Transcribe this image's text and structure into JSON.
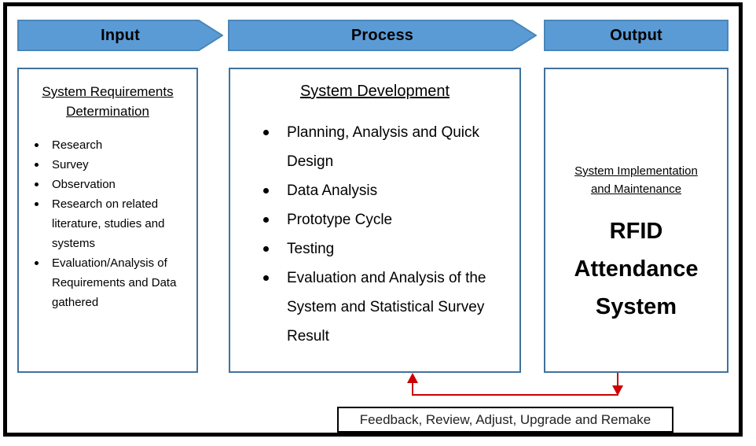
{
  "diagram": {
    "title": "Input Process Output diagram for RFID Attendance System",
    "accent_blue": "#5B9BD5",
    "box_border_blue": "#41719C",
    "feedback_red": "#CC0000",
    "frame_black": "#000000"
  },
  "headers": [
    {
      "label": "Input",
      "shape": "chevron-arrow"
    },
    {
      "label": "Process",
      "shape": "chevron-arrow"
    },
    {
      "label": "Output",
      "shape": "rectangle"
    }
  ],
  "columns": {
    "input": {
      "title_line1": "System Requirements",
      "title_line2": "Determination",
      "items": [
        "Research",
        "Survey",
        "Observation",
        "Research on related literature, studies and systems",
        "Evaluation/Analysis of Requirements and Data gathered"
      ]
    },
    "process": {
      "title": "System Development",
      "items": [
        "Planning, Analysis and Quick Design",
        "Data Analysis",
        "Prototype Cycle",
        "Testing",
        "Evaluation and Analysis of the System and Statistical Survey Result"
      ]
    },
    "output": {
      "subtitle_line1": "System Implementation",
      "subtitle_line2": "and Maintenance",
      "main_line1": "RFID",
      "main_line2": "Attendance",
      "main_line3": "System"
    }
  },
  "feedback": {
    "label": "Feedback, Review, Adjust, Upgrade and Remake"
  }
}
